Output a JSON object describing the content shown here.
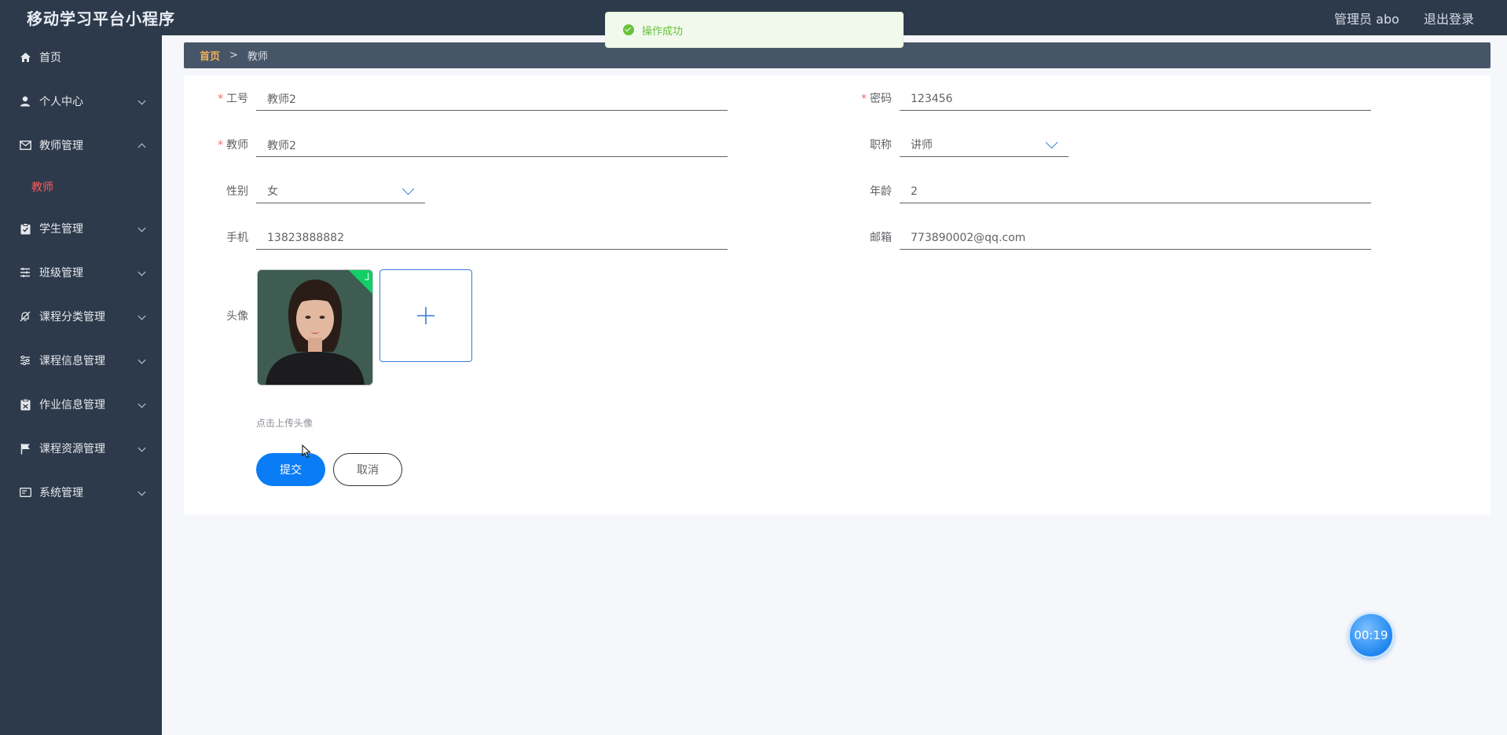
{
  "header": {
    "app_title": "移动学习平台小程序",
    "user_label": "管理员 abo",
    "logout_label": "退出登录"
  },
  "sidebar": {
    "items": [
      {
        "label": "首页",
        "icon": "home-icon"
      },
      {
        "label": "个人中心",
        "icon": "user-icon"
      },
      {
        "label": "教师管理",
        "icon": "mail-icon",
        "expanded": true,
        "children": [
          {
            "label": "教师"
          }
        ]
      },
      {
        "label": "学生管理",
        "icon": "clipboard-icon"
      },
      {
        "label": "班级管理",
        "icon": "list-icon"
      },
      {
        "label": "课程分类管理",
        "icon": "bell-off-icon"
      },
      {
        "label": "课程信息管理",
        "icon": "sliders-icon"
      },
      {
        "label": "作业信息管理",
        "icon": "document-icon"
      },
      {
        "label": "课程资源管理",
        "icon": "flag-icon"
      },
      {
        "label": "系统管理",
        "icon": "id-card-icon"
      }
    ]
  },
  "breadcrumb": {
    "home": "首页",
    "separator": ">",
    "current": "教师"
  },
  "form": {
    "gonghao": {
      "label": "工号",
      "value": "教师2"
    },
    "mima": {
      "label": "密码",
      "value": "123456"
    },
    "jiaoshi": {
      "label": "教师",
      "value": "教师2"
    },
    "zhicheng": {
      "label": "职称",
      "value": "讲师"
    },
    "xingbie": {
      "label": "性别",
      "value": "女"
    },
    "nianling": {
      "label": "年龄",
      "value": "2"
    },
    "shouji": {
      "label": "手机",
      "value": "13823888882"
    },
    "youxiang": {
      "label": "邮箱",
      "value": "773890002@qq.com"
    },
    "touxiang": {
      "label": "头像",
      "hint": "点击上传头像"
    },
    "submit_label": "提交",
    "cancel_label": "取消"
  },
  "toast": {
    "message": "操作成功",
    "color": "#67c23a"
  },
  "timer": {
    "value": "00:19"
  },
  "colors": {
    "sidebar_bg": "#2d3a4b",
    "accent": "#0a7cf5",
    "active_menu": "#ff5b5b"
  }
}
